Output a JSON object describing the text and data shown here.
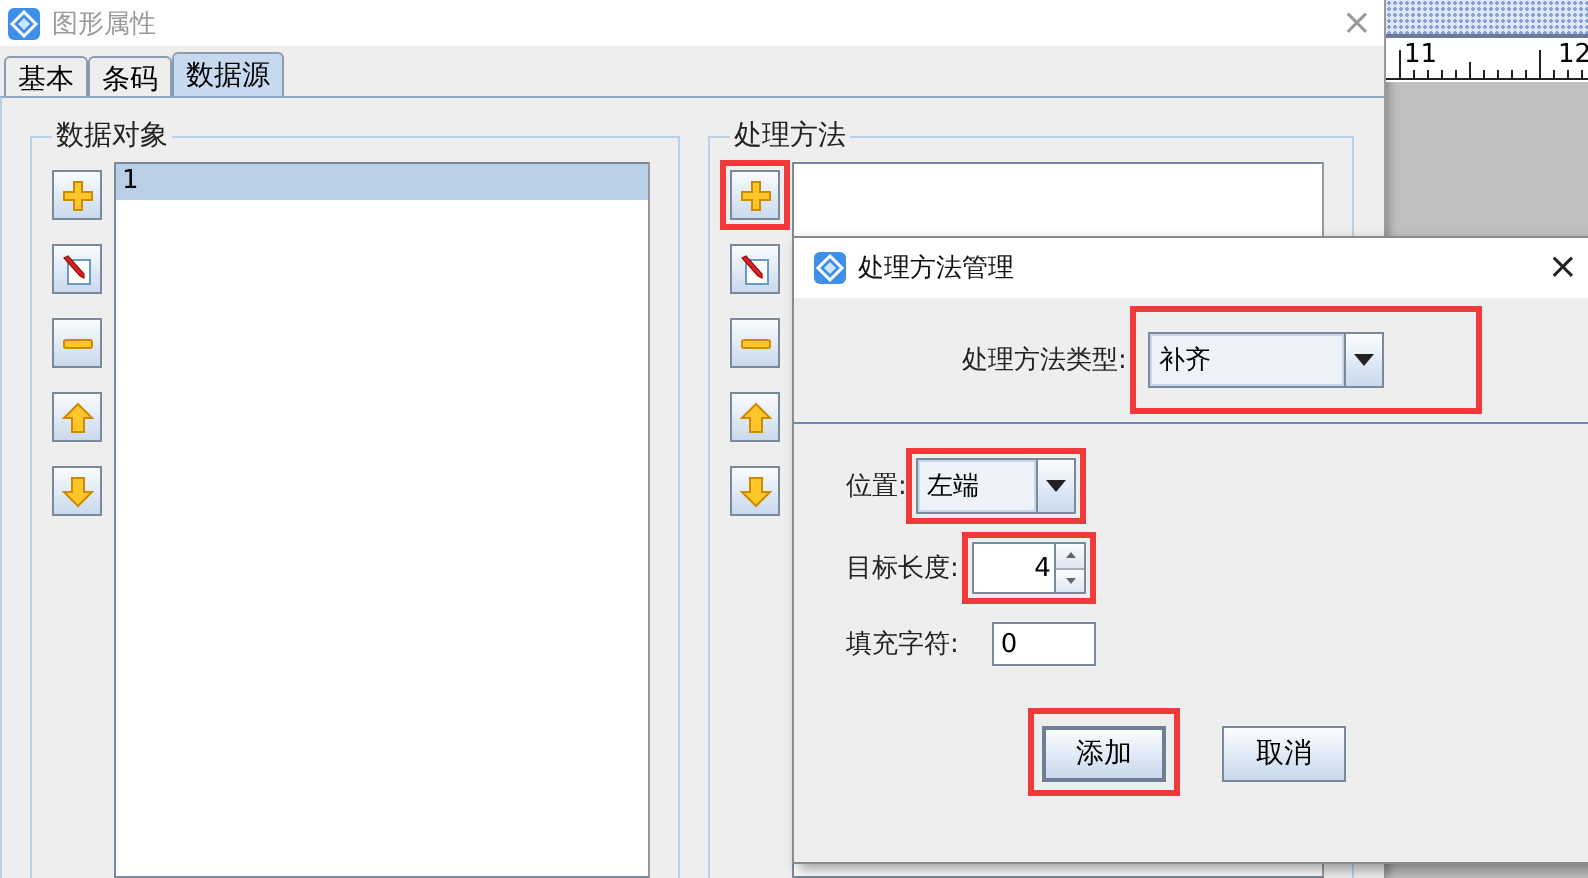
{
  "window": {
    "title": "图形属性",
    "close": "×"
  },
  "tabs": [
    {
      "label": "基本",
      "selected": false
    },
    {
      "label": "条码",
      "selected": false
    },
    {
      "label": "数据源",
      "selected": true
    }
  ],
  "data_objects": {
    "title": "数据对象",
    "items": [
      {
        "label": "1",
        "selected": true
      }
    ],
    "tools": [
      {
        "kind": "add",
        "highlighted": false
      },
      {
        "kind": "edit",
        "highlighted": false
      },
      {
        "kind": "remove",
        "highlighted": false
      },
      {
        "kind": "up",
        "highlighted": false
      },
      {
        "kind": "down",
        "highlighted": false
      }
    ]
  },
  "methods": {
    "title": "处理方法",
    "tools": [
      {
        "kind": "add",
        "highlighted": true
      },
      {
        "kind": "edit",
        "highlighted": false
      },
      {
        "kind": "remove",
        "highlighted": false
      },
      {
        "kind": "up",
        "highlighted": false
      },
      {
        "kind": "down",
        "highlighted": false
      }
    ]
  },
  "ruler": {
    "labels": [
      "11",
      "12"
    ]
  },
  "dialog": {
    "title": "处理方法管理",
    "close": "×",
    "type_label": "处理方法类型:",
    "type_value": "补齐",
    "type_highlighted": true,
    "fields": [
      {
        "kind": "combo",
        "label": "位置:",
        "value": "左端",
        "highlighted": true
      },
      {
        "kind": "spinner",
        "label": "目标长度:",
        "value": "4",
        "highlighted": true
      },
      {
        "kind": "text",
        "label": "填充字符:",
        "value": "0",
        "highlighted": false
      }
    ],
    "buttons": [
      {
        "label": "添加",
        "default": true,
        "highlighted": true
      },
      {
        "label": "取消",
        "default": false,
        "highlighted": false
      }
    ]
  }
}
